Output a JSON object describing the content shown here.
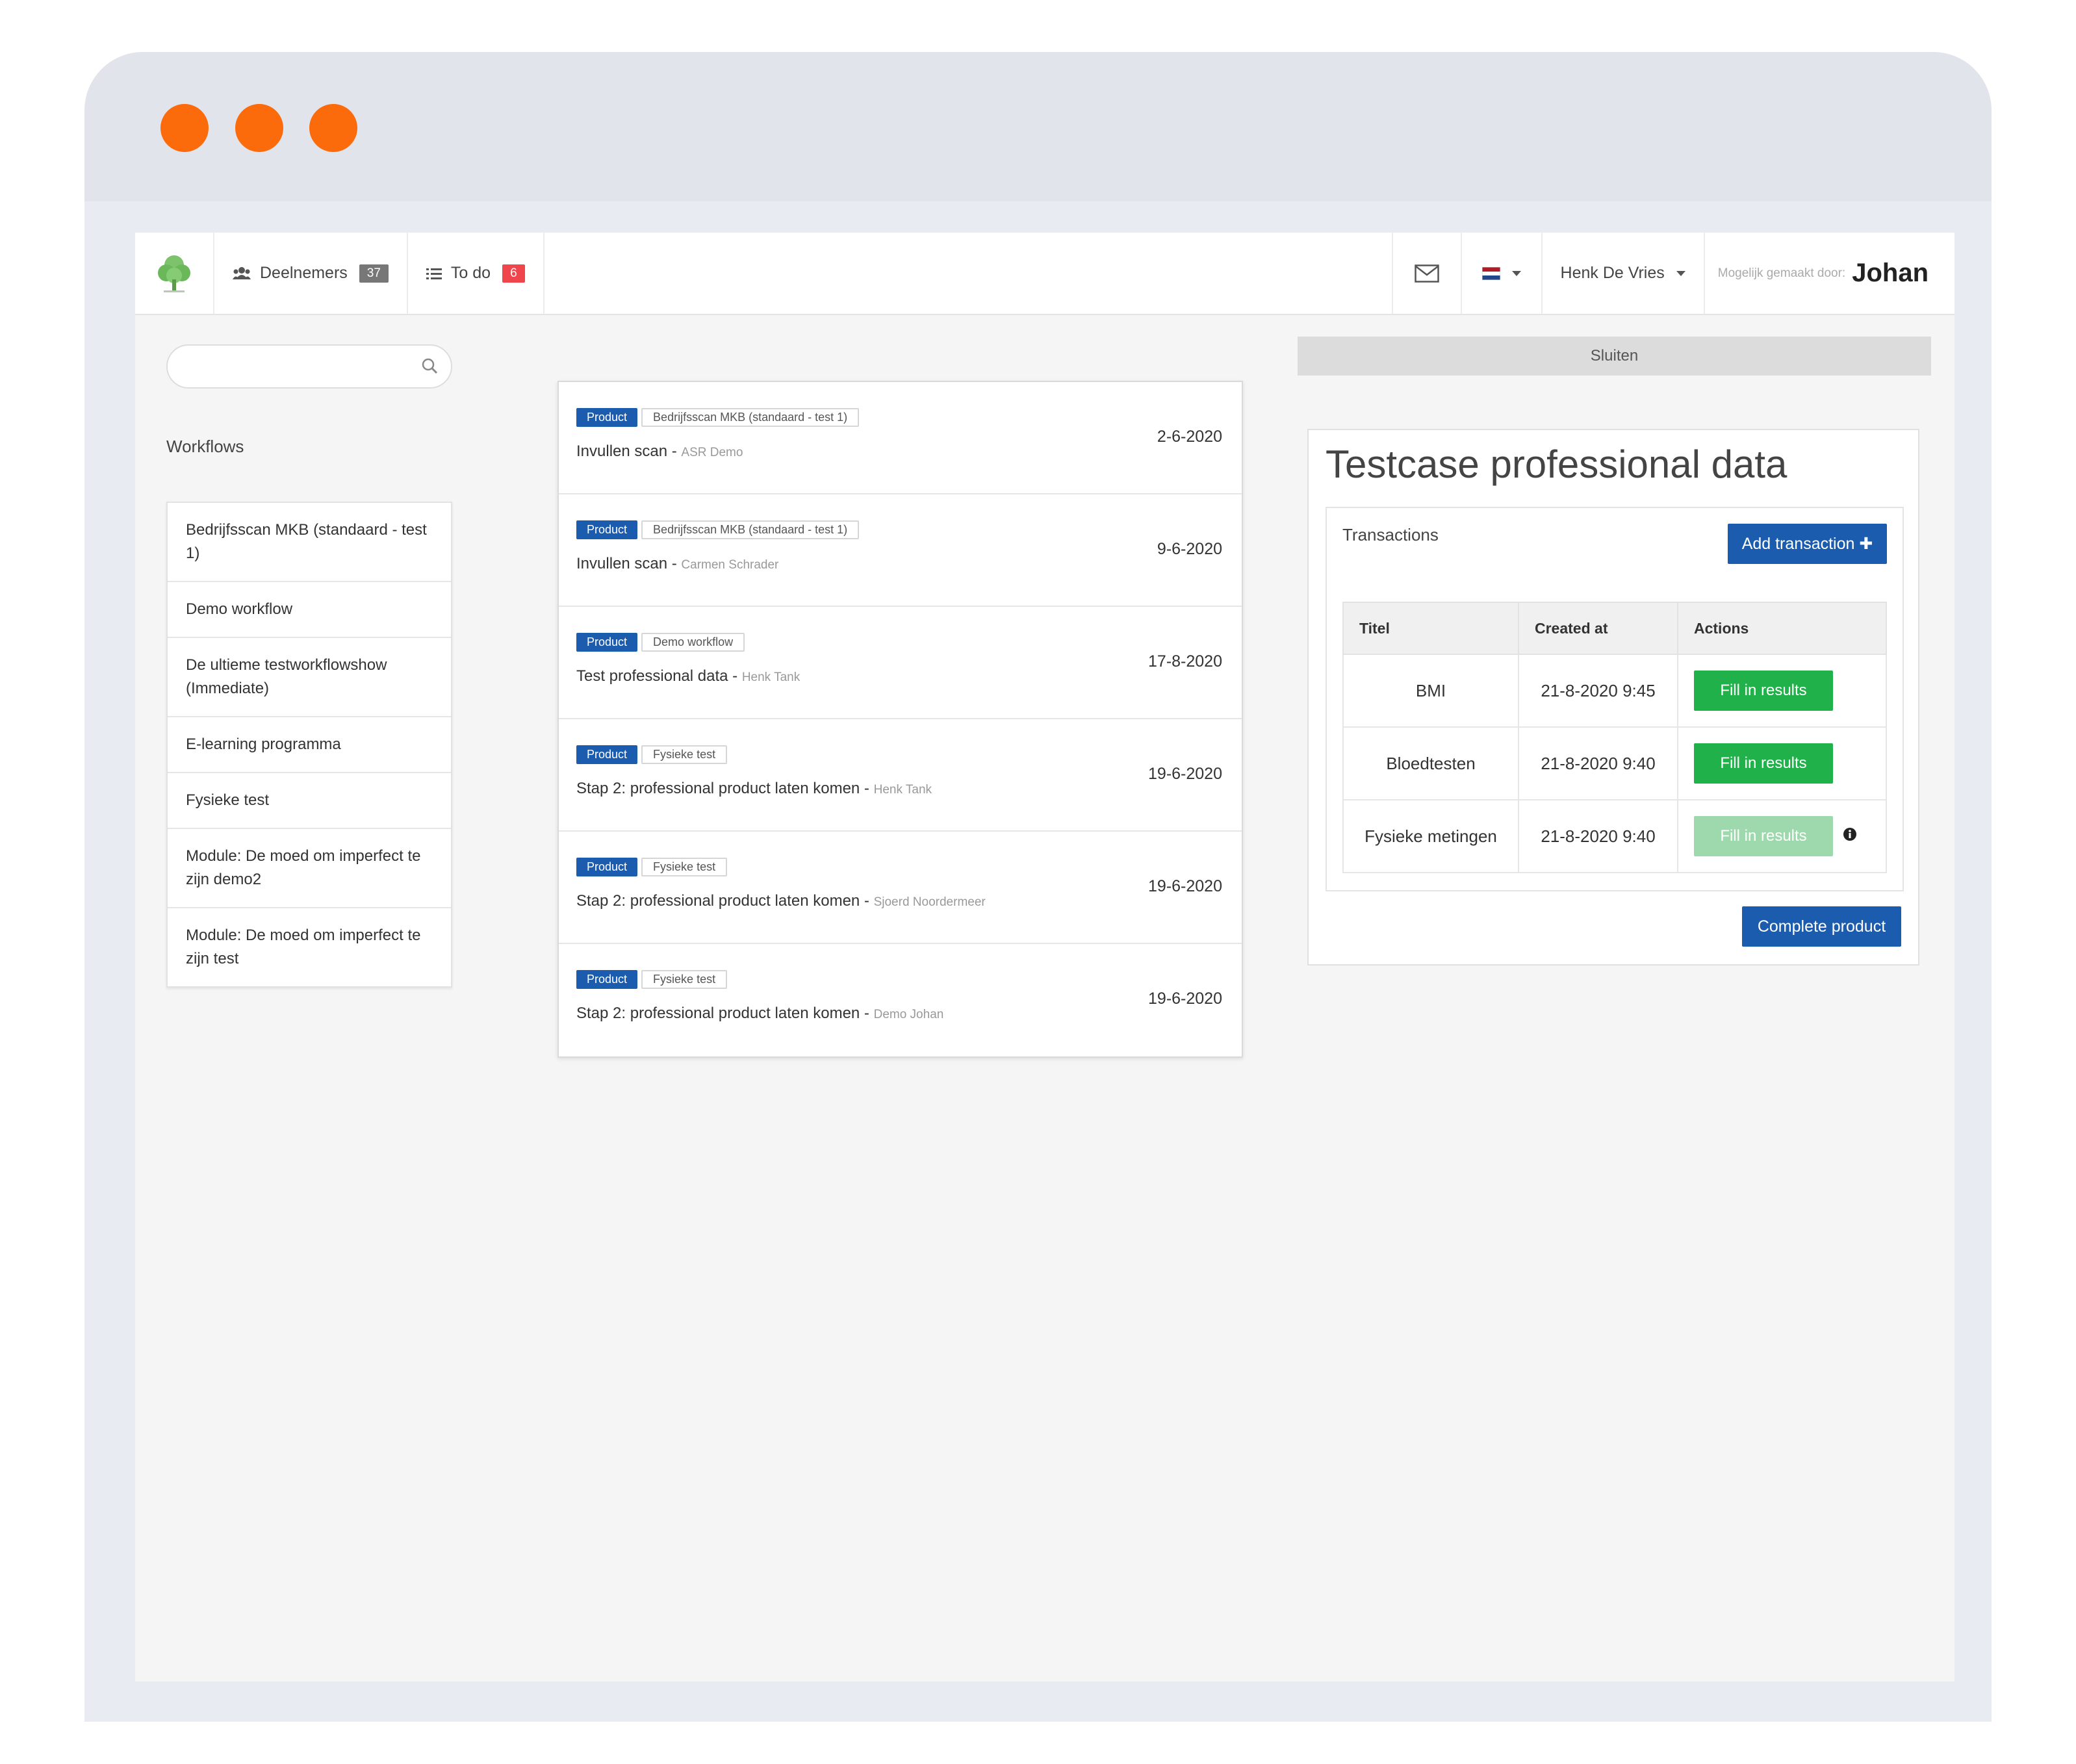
{
  "colors": {
    "accent": "#1b5cae",
    "success": "#21b14a",
    "window_dots": "#fb6b0b"
  },
  "navbar": {
    "participants_label": "Deelnemers",
    "participants_count": "37",
    "todo_label": "To do",
    "todo_count": "6",
    "user_name": "Henk De Vries",
    "made_by_label": "Mogelijk gemaakt door:",
    "made_by_name": "Johan",
    "icons": [
      "tree-logo-icon",
      "users-icon",
      "list-icon",
      "mail-icon",
      "flag-nl-icon"
    ]
  },
  "search": {
    "placeholder": ""
  },
  "workflows": {
    "heading": "Workflows",
    "items": [
      "Bedrijfsscan MKB (standaard - test 1)",
      "Demo workflow",
      "De ultieme testworkflowshow (Immediate)",
      "E-learning programma",
      "Fysieke test",
      "Module: De moed om imperfect te zijn demo2",
      "Module: De moed om imperfect te zijn test"
    ]
  },
  "tasks": [
    {
      "type": "Product",
      "workflow": "Bedrijfsscan MKB (standaard - test 1)",
      "title": "Invullen scan - ",
      "author": "ASR Demo",
      "date": "2-6-2020"
    },
    {
      "type": "Product",
      "workflow": "Bedrijfsscan MKB (standaard - test 1)",
      "title": "Invullen scan - ",
      "author": "Carmen Schrader",
      "date": "9-6-2020"
    },
    {
      "type": "Product",
      "workflow": "Demo workflow",
      "title": "Test professional data - ",
      "author": "Henk Tank",
      "date": "17-8-2020"
    },
    {
      "type": "Product",
      "workflow": "Fysieke test",
      "title": "Stap 2: professional product laten komen - ",
      "author": "Henk Tank",
      "date": "19-6-2020"
    },
    {
      "type": "Product",
      "workflow": "Fysieke test",
      "title": "Stap 2: professional product laten komen - ",
      "author": "Sjoerd Noordermeer",
      "date": "19-6-2020"
    },
    {
      "type": "Product",
      "workflow": "Fysieke test",
      "title": "Stap 2: professional product laten komen - ",
      "author": "Demo Johan",
      "date": "19-6-2020"
    }
  ],
  "detail": {
    "close_label": "Sluiten",
    "title": "Testcase professional data",
    "transactions_label": "Transactions",
    "add_button": "Add transaction ✚",
    "columns": [
      "Titel",
      "Created at",
      "Actions"
    ],
    "rows": [
      {
        "title": "BMI",
        "created": "21-8-2020 9:45",
        "action": "Fill in results",
        "enabled": true
      },
      {
        "title": "Bloedtesten",
        "created": "21-8-2020 9:40",
        "action": "Fill in results",
        "enabled": true
      },
      {
        "title": "Fysieke metingen",
        "created": "21-8-2020 9:40",
        "action": "Fill in results",
        "enabled": false
      }
    ],
    "complete_button": "Complete product"
  }
}
